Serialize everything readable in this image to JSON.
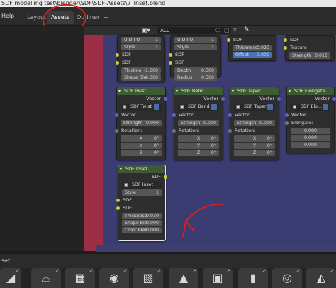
{
  "window": {
    "title": "SDF modelling test\\blender\\SDF\\SDF-Assets\\7_Inset.blend"
  },
  "menu": {
    "help": "Help"
  },
  "tabs": [
    {
      "label": "Layout"
    },
    {
      "label": "Assets"
    },
    {
      "label": "Outliner"
    }
  ],
  "tab_add": "+",
  "header": {
    "filter_label": "ALL",
    "pin_icon": "pin-icon"
  },
  "nodes": {
    "topleft": {
      "udio_label": "U D I O",
      "udio_value": "1",
      "style_label": "Style",
      "style_value": "1",
      "sdf_out": "SDF",
      "sdf_in": "SDF",
      "thickness_label": "Thickne",
      "thickness_value": "-1.000",
      "shape_label": "Shape Ble",
      "shape_value": "0.000"
    },
    "topmid": {
      "udio_label": "U D I O",
      "udio_value": "1",
      "style_label": "Style",
      "style_value": "1",
      "sdf_out": "SDF",
      "sdf_in": "SDF",
      "depth_label": "Depth",
      "depth_value": "0.500",
      "radius_label": "Radius",
      "radius_value": "0.500"
    },
    "topright": {
      "sdf": "SDF",
      "thickness_label": "Thickness",
      "thickness_value": "0.020",
      "offset_label": "Offset",
      "offset_value": "0.000"
    },
    "texture": {
      "sdf": "SDF",
      "texture": "Texture",
      "strength_label": "Strength",
      "strength_value": "0.010"
    },
    "twist": {
      "title": "SDF Twist",
      "vector_out": "Vector",
      "select": "SDF Twist",
      "vector_in": "Vector",
      "strength_label": "Strength",
      "strength_value": "0.000",
      "rotation": "Rotation:",
      "x_label": "X",
      "x_value": "0°",
      "y_label": "Y",
      "y_value": "0°",
      "z_label": "Z",
      "z_value": "0°"
    },
    "bend": {
      "title": "SDF Bend",
      "vector_out": "Vector",
      "select": "SDF Bend",
      "vector_in": "Vector",
      "strength_label": "Strength",
      "strength_value": "0.000",
      "rotation": "Rotation:",
      "x_label": "X",
      "x_value": "0°",
      "y_label": "Y",
      "y_value": "0°",
      "z_label": "Z",
      "z_value": "0°"
    },
    "taper": {
      "title": "SDF Taper",
      "vector_out": "Vector",
      "select": "SDF Taper",
      "vector_in": "Vector",
      "strength_label": "Strength",
      "strength_value": "0.000",
      "rotation": "Rotation:",
      "x_label": "X",
      "x_value": "0°",
      "y_label": "Y",
      "y_value": "0°",
      "z_label": "Z",
      "z_value": "0°"
    },
    "elongate": {
      "title": "SDF Elongate",
      "vector_out": "Vector",
      "select": "SDF Elo...",
      "vector_in": "Vector",
      "elongate": "Elongate:",
      "v1": "0.000",
      "v2": "0.000",
      "v3": "0.000"
    },
    "inset": {
      "title": "SDF Inset",
      "sdf_out": "SDF",
      "select": "SDF Inset",
      "style_label": "Style",
      "style_value": "1",
      "sdf_in1": "SDF",
      "sdf_in2": "SDF",
      "thickness_label": "Thickness",
      "thickness_value": "0.030",
      "shape_label": "Shape Ble",
      "shape_value": "0.000",
      "color_label": "Color Blen",
      "color_value": "0.000"
    }
  },
  "shelf": {
    "label": "set"
  },
  "colors": {
    "annotation": "#d62020",
    "node_header": "#3e5a35",
    "editor_bg": "#3b3d72",
    "strip": "#9c2f45"
  }
}
